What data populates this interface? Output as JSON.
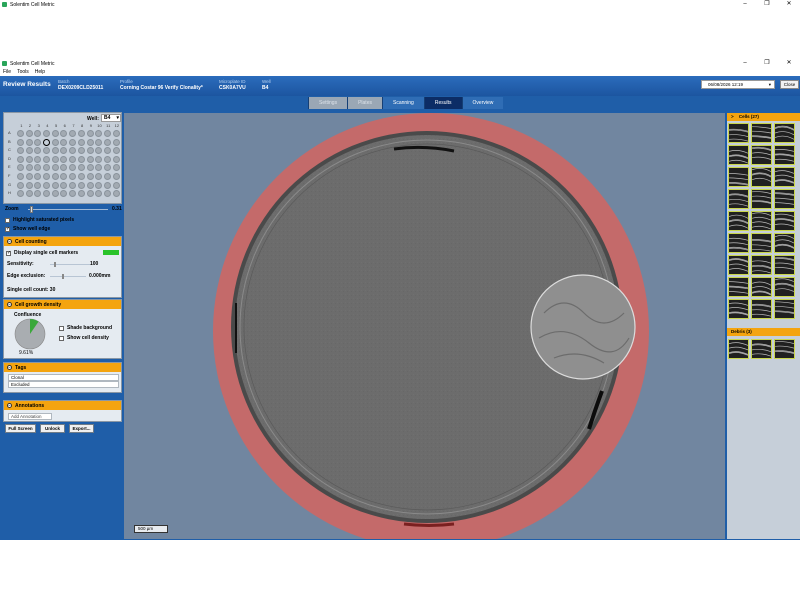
{
  "window": {
    "title": "Solentim Cell Metric"
  },
  "menu": [
    "File",
    "Tools",
    "Help"
  ],
  "header": {
    "page_title": "Review Results",
    "batch_label": "Batch",
    "batch_value": "DEX0209CLD25011",
    "profile_label": "Profile",
    "profile_value": "Corning Costar 96 Verify Clonality*",
    "microplate_label": "Microplate ID",
    "microplate_value": "CSK0A7VU",
    "well_label": "Well",
    "well_value": "B4",
    "datetime": "06/08/2026 12:19",
    "close_label": "Close"
  },
  "tabs": [
    {
      "label": "Settings",
      "state": "disabled"
    },
    {
      "label": "Plates",
      "state": "disabled"
    },
    {
      "label": "Scanning",
      "state": "normal"
    },
    {
      "label": "Results",
      "state": "active"
    },
    {
      "label": "Overview",
      "state": "normal"
    }
  ],
  "plate": {
    "well_label": "Well:",
    "well_value": "B4",
    "columns": [
      "1",
      "2",
      "3",
      "4",
      "5",
      "6",
      "7",
      "8",
      "9",
      "10",
      "11",
      "12"
    ],
    "rows": [
      "A",
      "B",
      "C",
      "D",
      "E",
      "F",
      "G",
      "H"
    ],
    "selected_row": 1,
    "selected_col": 3
  },
  "zoom": {
    "label": "Zoom",
    "value": "0.31"
  },
  "options": {
    "highlight_saturated": "Highlight saturated pixels",
    "show_well_edge": "Show well edge"
  },
  "cell_counting": {
    "title": "Cell counting",
    "display_markers": "Display single cell markers",
    "sensitivity_label": "Sensitivity:",
    "sensitivity_value": "100",
    "edge_label": "Edge exclusion:",
    "edge_value": "0.000mm",
    "count_label": "Single cell count:",
    "count_value": "30",
    "marker_color": "#2ac32a"
  },
  "growth": {
    "title": "Cell growth density",
    "confluence_label": "Confluence",
    "confluence_value": "9.61%",
    "confluence_fraction": 0.0961,
    "shade_background": "Shade background",
    "show_density": "Show cell density"
  },
  "tags": {
    "title": "Tags",
    "items": [
      "Clonal",
      "Excluded"
    ]
  },
  "annotations": {
    "title": "Annotations",
    "add_label": "Add Annotation"
  },
  "buttons": {
    "full_screen": "Full Screen",
    "unlock": "Unlock",
    "export": "Export..."
  },
  "viewer": {
    "scale_label": "500 µm"
  },
  "cells": {
    "title": "Cells (27)",
    "debris_title": "Debris (3)"
  },
  "colors": {
    "accent": "#f4a40f",
    "header": "#1f5ea8",
    "well_edge": "#c45a5a"
  }
}
